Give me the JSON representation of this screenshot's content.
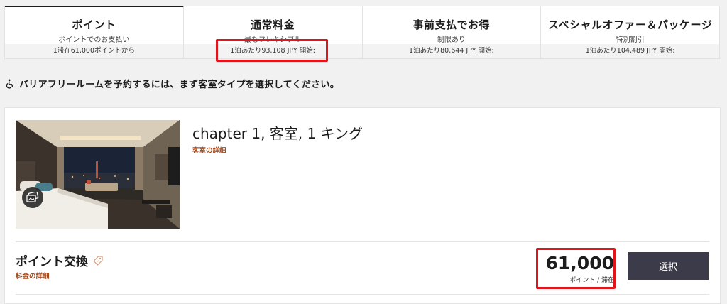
{
  "tabs": [
    {
      "title": "ポイント",
      "subtitle": "ポイントでのお支払い",
      "price": "1滞在61,000ポイントから"
    },
    {
      "title": "通常料金",
      "subtitle": "最もフレキシブル",
      "price": "1泊あたり93,108 JPY 開始:"
    },
    {
      "title": "事前支払でお得",
      "subtitle": "制限あり",
      "price": "1泊あたり80,644 JPY 開始:"
    },
    {
      "title": "スペシャルオファー＆パッケージ",
      "subtitle": "特別割引",
      "price": "1泊あたり104,489 JPY 開始:"
    }
  ],
  "active_tab": "ポイント",
  "highlight_color": "#e0161c",
  "notice": {
    "text": "バリアフリールームを予約するには、まず客室タイプを選択してください。",
    "icon": "wheelchair-icon"
  },
  "room": {
    "name": "chapter 1, 客室, 1 キング",
    "details_link": "客室の詳細",
    "photo_icon": "gallery-icon"
  },
  "rate": {
    "name": "ポイント交換",
    "tag_icon": "tag-icon",
    "details_link": "料金の詳細",
    "points": "61,000",
    "unit": "ポイント / 滞在",
    "select_label": "選択"
  },
  "colors": {
    "accent_link": "#a64b1f",
    "button_bg": "#3c3b4a"
  }
}
